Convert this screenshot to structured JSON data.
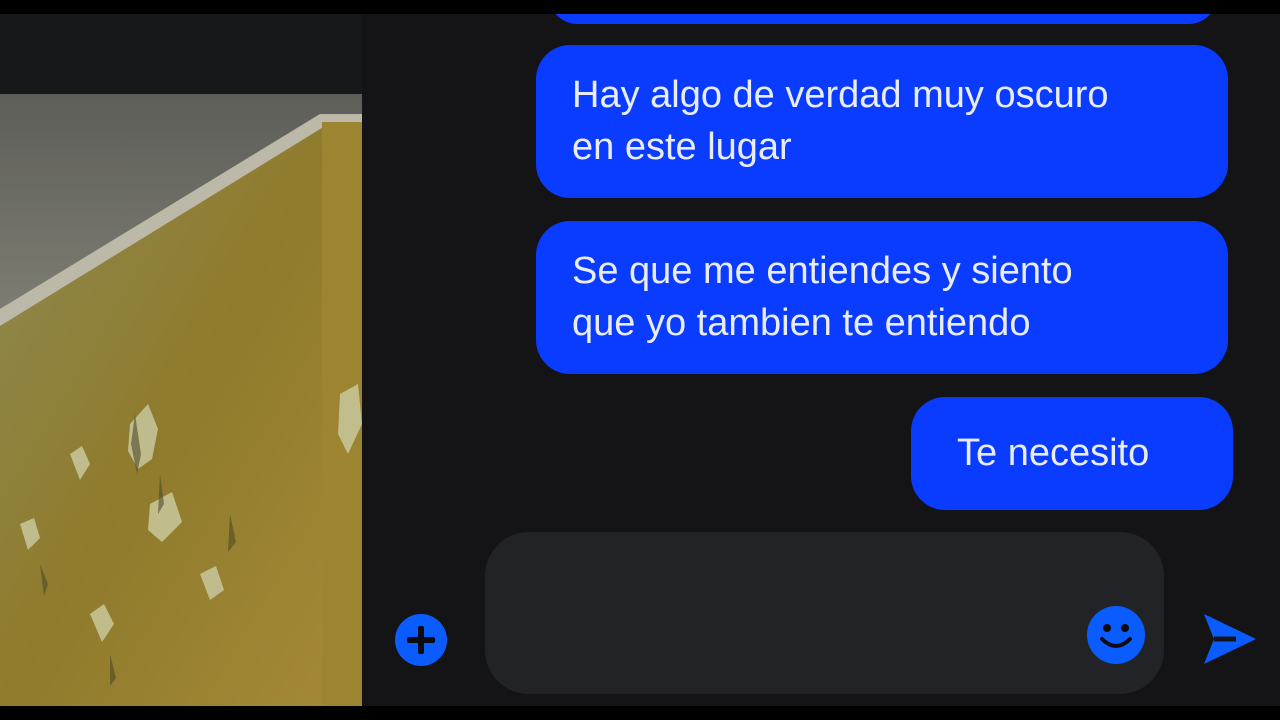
{
  "colors": {
    "bubble": "#0a3cff",
    "accent": "#0a5cff",
    "background": "#141417",
    "composer": "#222326",
    "text": "#e9ecf5"
  },
  "messages": [
    {
      "lines": [
        "Hay algo de verdad muy oscuro",
        "en este lugar"
      ]
    },
    {
      "lines": [
        "Se que me entiendes y siento",
        "que yo tambien te entiendo"
      ]
    },
    {
      "lines": [
        "Te necesito"
      ]
    }
  ],
  "composer": {
    "value": "",
    "placeholder": "",
    "add_icon": "plus-icon",
    "emoji_icon": "smiley-icon",
    "send_icon": "send-arrow-icon"
  }
}
